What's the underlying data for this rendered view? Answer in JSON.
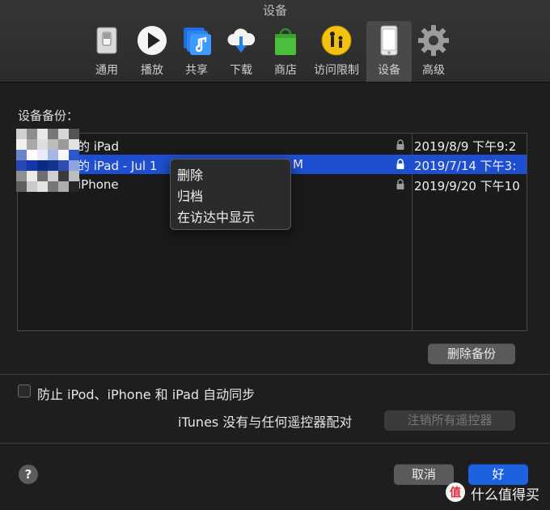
{
  "window": {
    "title": "设备"
  },
  "toolbar": {
    "items": [
      {
        "label": "通用",
        "icon": "general-switch-icon"
      },
      {
        "label": "播放",
        "icon": "play-icon"
      },
      {
        "label": "共享",
        "icon": "music-share-icon"
      },
      {
        "label": "下载",
        "icon": "cloud-download-icon"
      },
      {
        "label": "商店",
        "icon": "store-bag-icon"
      },
      {
        "label": "访问限制",
        "icon": "parental-controls-icon"
      },
      {
        "label": "设备",
        "icon": "device-iphone-icon",
        "selected": true
      },
      {
        "label": "高级",
        "icon": "gear-icon"
      }
    ]
  },
  "backups": {
    "title": "设备备份：",
    "rows": [
      {
        "name": "的 iPad",
        "date": "2019/8/9 下午9:2",
        "locked": true,
        "selected": false
      },
      {
        "name": "的 iPad - Jul 1",
        "name_tail": "M",
        "date": "2019/7/14 下午3:",
        "locked": true,
        "selected": true
      },
      {
        "name": "iPhone",
        "date": "2019/9/20 下午10",
        "locked": true,
        "selected": false
      }
    ],
    "delete_button": "删除备份"
  },
  "context_menu": {
    "items": [
      "删除",
      "归档",
      "在访达中显示"
    ]
  },
  "sync": {
    "prevent_auto_sync_label": "防止 iPod、iPhone 和 iPad 自动同步",
    "prevent_auto_sync_checked": false
  },
  "remotes": {
    "status_text": "iTunes 没有与任何遥控器配对",
    "unpair_button": "注销所有遥控器"
  },
  "footer": {
    "help_label": "?",
    "cancel_button": "取消",
    "ok_button": "好"
  },
  "watermark": {
    "text": "什么值得买"
  },
  "colors": {
    "accent": "#1b61e0",
    "selection": "#1e4fd0",
    "background": "#1e1e1e"
  }
}
